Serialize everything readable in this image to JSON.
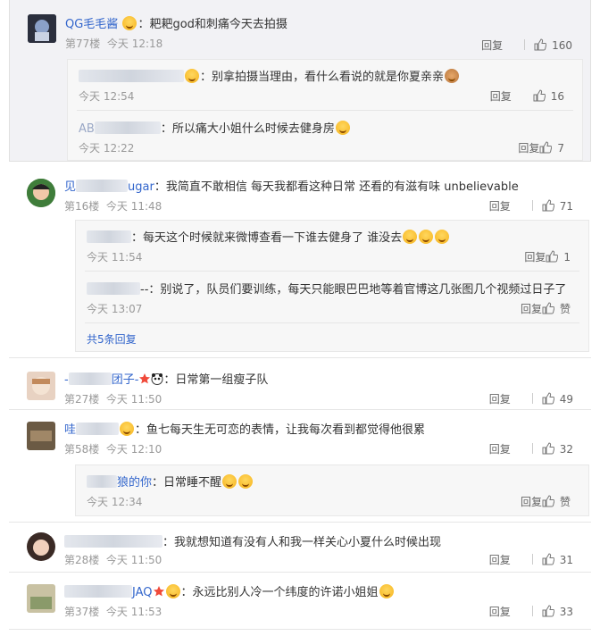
{
  "actions": {
    "reply_label": "回复",
    "like_icon": "thumbs-up-icon"
  },
  "comments": [
    {
      "name": "QG毛毛酱",
      "text": "：耙耙god和刺痛今天去拍摄",
      "floor": "第77楼",
      "time": "今天 12:18",
      "likes": "160",
      "replies": [
        {
          "name_visible": "",
          "text": "：别拿拍摄当理由，看什么看说的就是你夏亲亲",
          "time": "今天 12:54",
          "likes": "16"
        },
        {
          "name_visible": "AB",
          "text": "：所以痛大小姐什么时候去健身房",
          "time": "今天 12:22",
          "likes": "7"
        }
      ]
    },
    {
      "name": "见",
      "name_tail": "ugar",
      "text": "：我简直不敢相信 每天我都看这种日常 还看的有滋有味 unbelievable",
      "floor": "第16楼",
      "time": "今天 11:48",
      "likes": "71",
      "replies": [
        {
          "name_visible": "",
          "text": "：每天这个时候就来微博查看一下谁去健身了 谁没去",
          "time": "今天 11:54",
          "likes": "1"
        },
        {
          "name_visible": "",
          "text": "--：别说了，队员们要训练，每天只能眼巴巴地等着官博这几张图几个视频过日子了",
          "time": "今天 13:07",
          "likes": "赞"
        }
      ],
      "more": "共5条回复"
    },
    {
      "name": "-",
      "name_tail": "团子-",
      "text": "：日常第一组瘦子队",
      "floor": "第27楼",
      "time": "今天 11:50",
      "likes": "49"
    },
    {
      "name": "哇",
      "text": "：鱼七每天生无可恋的表情，让我每次看到都觉得他很累",
      "floor": "第58楼",
      "time": "今天 12:10",
      "likes": "32",
      "replies": [
        {
          "name_visible": "狼的你",
          "text": "：日常睡不醒",
          "time": "今天 12:34",
          "likes": "赞"
        }
      ]
    },
    {
      "name": "",
      "text": "：我就想知道有没有人和我一样关心小夏什么时候出现",
      "floor": "第28楼",
      "time": "今天 11:50",
      "likes": "31"
    },
    {
      "name": "",
      "name_tail": "JAQ",
      "text": "：永远比别人冷一个纬度的许诺小姐姐",
      "floor": "第37楼",
      "time": "今天 11:53",
      "likes": "33"
    }
  ]
}
